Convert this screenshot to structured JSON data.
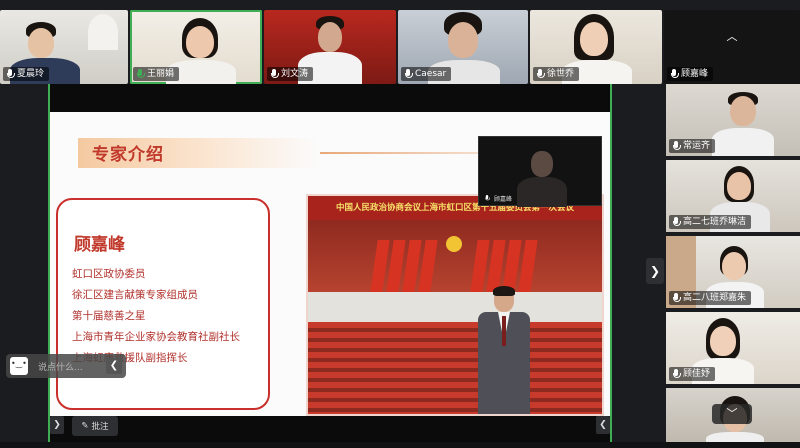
{
  "participants_top": [
    {
      "name": "夏晨玲",
      "active": false
    },
    {
      "name": "王丽娟",
      "active": true
    },
    {
      "name": "刘文涛",
      "active": false
    },
    {
      "name": "Caesar",
      "active": false
    },
    {
      "name": "徐世乔",
      "active": false
    },
    {
      "name": "顾嘉峰",
      "active": false
    }
  ],
  "participants_right": [
    {
      "name": "常运齐"
    },
    {
      "name": "高二七班乔琳洁"
    },
    {
      "name": "高二八班郑嘉朱"
    },
    {
      "name": "顾佳妤"
    }
  ],
  "slide": {
    "section_title": "专家介绍",
    "expert_name": "顾嘉峰",
    "roles": [
      "虹口区政协委员",
      "徐汇区建言献策专家组成员",
      "第十届慈善之星",
      "上海市青年企业家协会教育社副社长",
      "上海虹康救援队副指挥长"
    ],
    "photo_banner": "中国人民政治协商会议上海市虹口区第十五届委员会第一次会议",
    "presenter_tag": "顾嘉峰"
  },
  "chat": {
    "placeholder": "说点什么...",
    "collapse_glyph": "❮"
  },
  "toolbar": {
    "annotate_label": "批注",
    "prev_glyph": "❯",
    "next_glyph": "❮"
  },
  "nav": {
    "next_glyph": "❯",
    "collapse_down_glyph": "﹀",
    "collapse_up_glyph": "︿"
  },
  "colors": {
    "accent_green": "#3fae55",
    "slide_red": "#c0392b"
  }
}
